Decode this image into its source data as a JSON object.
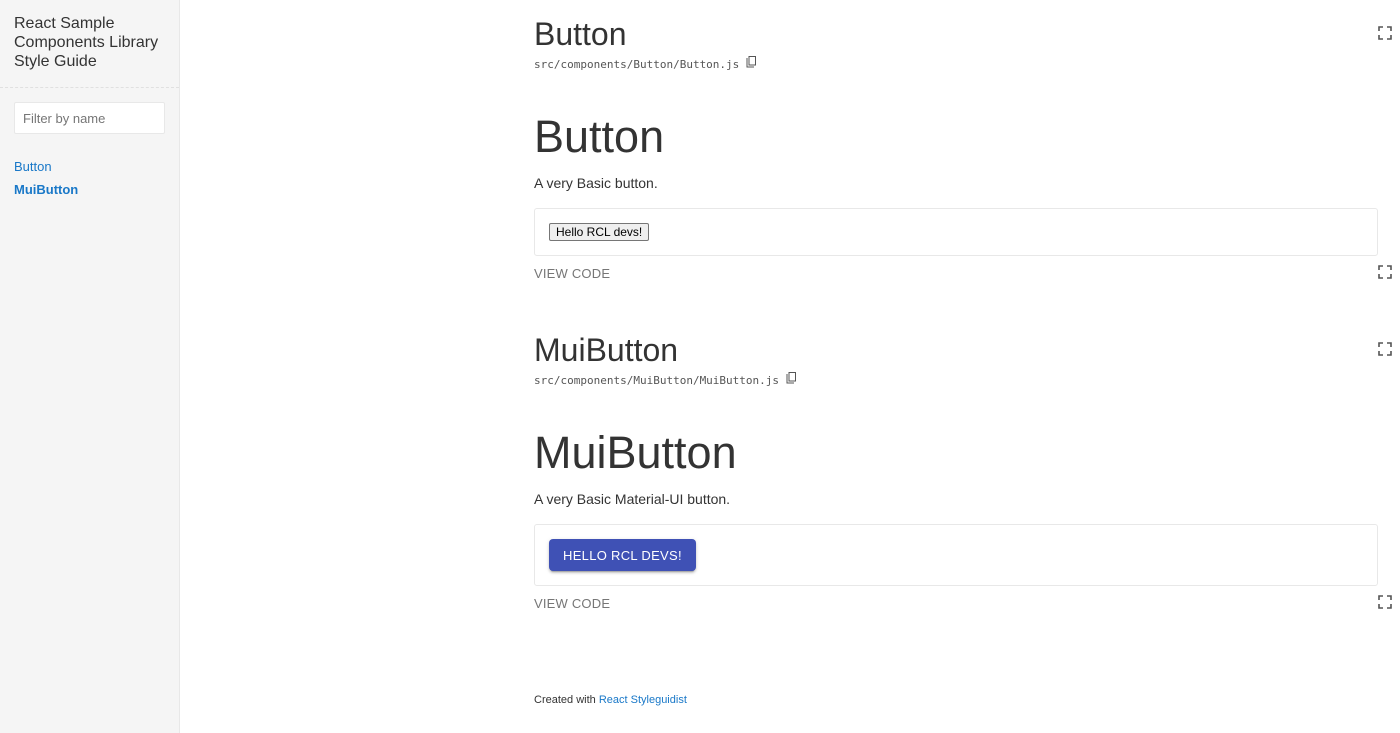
{
  "sidebar": {
    "title": "React Sample Components Library Style Guide",
    "filter": {
      "placeholder": "Filter by name",
      "value": ""
    },
    "items": [
      {
        "label": "Button",
        "active": false
      },
      {
        "label": "MuiButton",
        "active": true
      }
    ]
  },
  "sections": [
    {
      "title": "Button",
      "path": "src/components/Button/Button.js",
      "doc_title": "Button",
      "description": "A very Basic button.",
      "example_button_label": "Hello RCL devs!",
      "view_code_label": "VIEW CODE"
    },
    {
      "title": "MuiButton",
      "path": "src/components/MuiButton/MuiButton.js",
      "doc_title": "MuiButton",
      "description": "A very Basic Material-UI button.",
      "example_button_label": "HELLO RCL DEVS!",
      "view_code_label": "VIEW CODE"
    }
  ],
  "footer": {
    "prefix": "Created with",
    "link_label": "React Styleguidist"
  },
  "colors": {
    "link": "#1978c8",
    "mui_primary": "#3f51b5",
    "sidebar_bg": "#f5f5f5"
  }
}
